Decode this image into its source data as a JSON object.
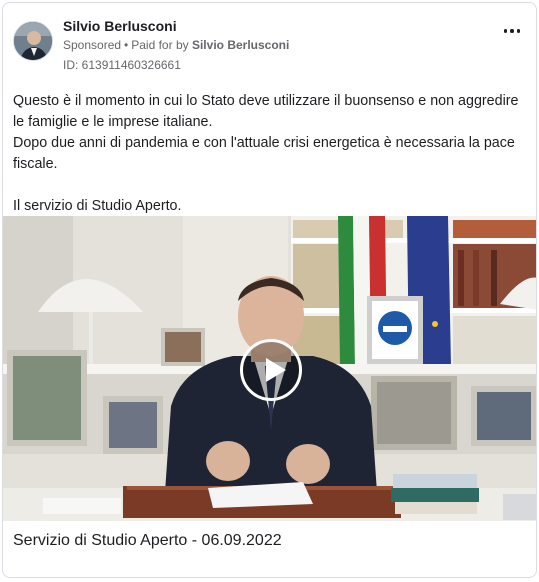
{
  "post": {
    "page_name": "Silvio Berlusconi",
    "sponsored_label": "Sponsored",
    "separator": "•",
    "paid_for_prefix": "Paid for by",
    "paid_for_name": "Silvio Berlusconi",
    "ad_id": "ID: 613911460326661",
    "body_lines": [
      "Questo è il momento in cui lo Stato deve utilizzare il buonsenso e non aggredire le famiglie e le imprese italiane.",
      "Dopo due anni di pandemia e con l'attuale crisi energetica è necessaria la pace fiscale.",
      "Il servizio di Studio Aperto."
    ],
    "video_caption": "Servizio di Studio Aperto - 06.09.2022",
    "more_icon": "more-horizontal-icon",
    "play_icon": "play-icon",
    "colors": {
      "text_primary": "#1c1e21",
      "text_secondary": "#65676b",
      "border": "#dadde1"
    }
  }
}
